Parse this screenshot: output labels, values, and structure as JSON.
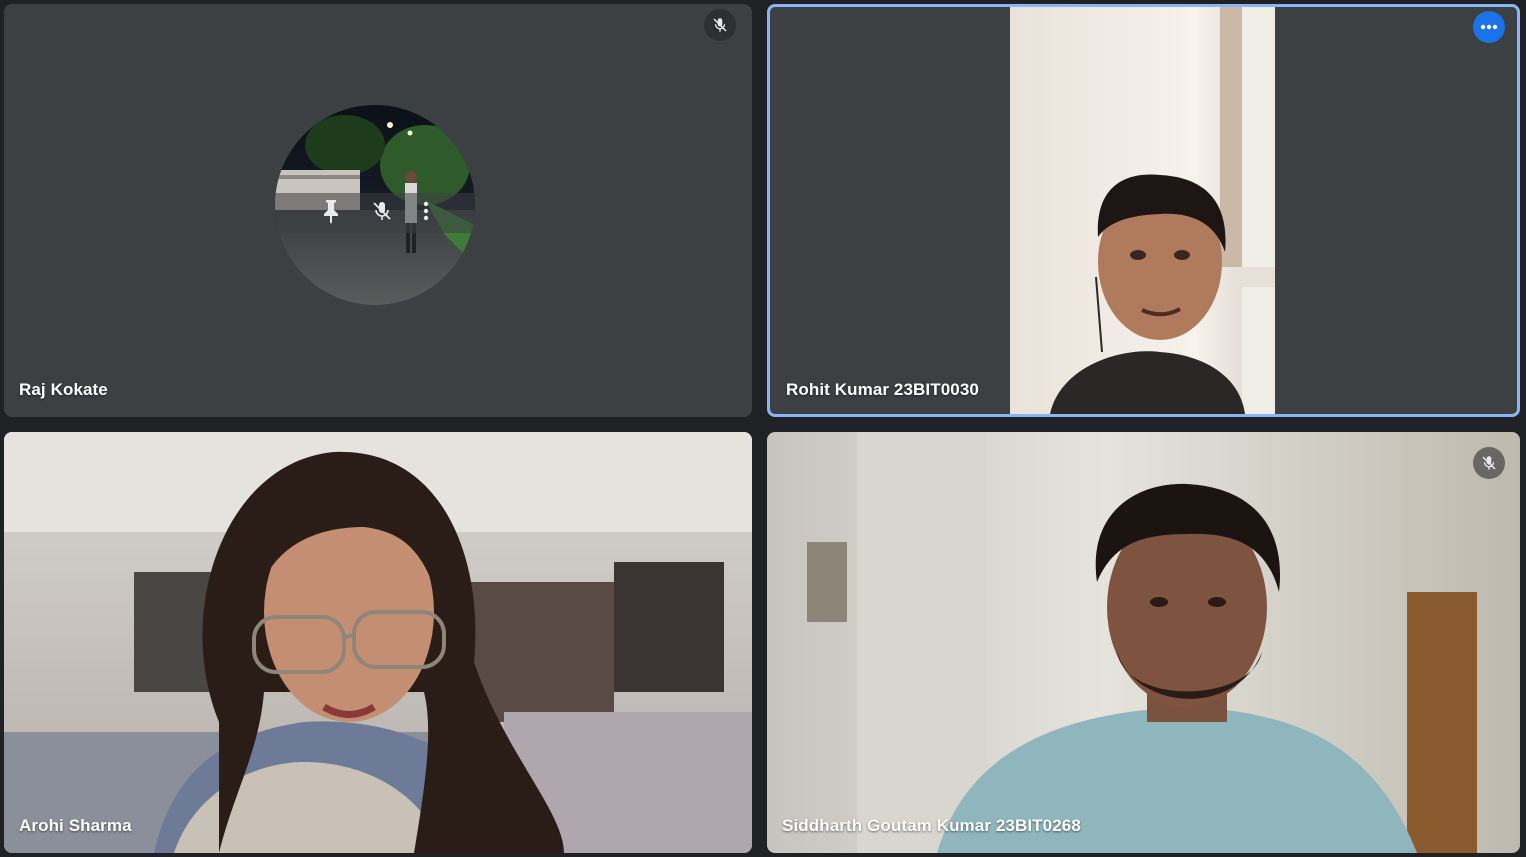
{
  "participants": [
    {
      "name": "Raj Kokate",
      "muted": true,
      "camera": "off",
      "mute_icon": "mic-off-icon"
    },
    {
      "name": "Rohit Kumar 23BIT0030",
      "muted": false,
      "camera": "on",
      "active_speaker": true,
      "menu_icon": "more-options-icon"
    },
    {
      "name": "Arohi Sharma",
      "muted": false,
      "camera": "on"
    },
    {
      "name": "Siddharth Goutam Kumar 23BIT0268",
      "muted": true,
      "camera": "on",
      "mute_icon": "mic-off-icon"
    }
  ],
  "colors": {
    "background": "#202124",
    "tile": "#3c4043",
    "active_border": "#8ab4f8",
    "menu_button": "#1a73e8"
  }
}
